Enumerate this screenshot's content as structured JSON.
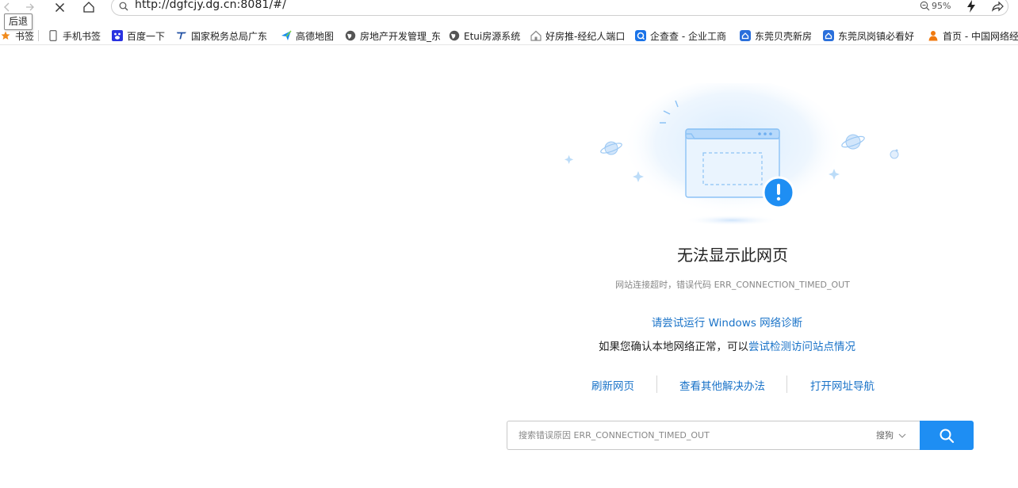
{
  "toolbar": {
    "tooltip": "后退",
    "url": "http://dgfcjy.dg.cn:8081/#/",
    "zoom": "95%",
    "icons": [
      "back-icon",
      "forward-icon",
      "stop-icon",
      "home-icon",
      "search-icon",
      "zoom-icon",
      "lightning-icon",
      "share-icon"
    ]
  },
  "bookmarks": {
    "items": [
      {
        "label": "书签",
        "icon": "star-icon",
        "color": "#f08a1c"
      },
      {
        "label": "手机书签",
        "icon": "phone-icon",
        "color": "#666666"
      },
      {
        "label": "百度一下",
        "icon": "baidu-icon",
        "color": "#2932e1"
      },
      {
        "label": "国家税务总局广东",
        "icon": "tax-icon",
        "color": "#1f4fa3"
      },
      {
        "label": "高德地图",
        "icon": "amap-icon",
        "color": "#1a8cf0"
      },
      {
        "label": "房地产开发管理_东",
        "icon": "globe-icon",
        "color": "#555555"
      },
      {
        "label": "Etui房源系统",
        "icon": "globe-icon",
        "color": "#555555"
      },
      {
        "label": "好房推-经纪人端口",
        "icon": "house-icon",
        "color": "#888888"
      },
      {
        "label": "企查查 - 企业工商",
        "icon": "qcc-icon",
        "color": "#1a73e8"
      },
      {
        "label": "东莞贝壳新房",
        "icon": "ke-icon",
        "color": "#2a6fdb"
      },
      {
        "label": "东莞凤岗镇必看好",
        "icon": "ke-icon",
        "color": "#2a6fdb"
      },
      {
        "label": "首页 - 中国网络经",
        "icon": "person-icon",
        "color": "#f07a10"
      }
    ]
  },
  "error": {
    "title": "无法显示此网页",
    "subtitle": "网站连接超时，错误代码 ERR_CONNECTION_TIMED_OUT",
    "diagnose_link": "请尝试运行 Windows 网络诊断",
    "confirm_prefix": "如果您确认本地网络正常，可以",
    "confirm_link": "尝试检测访问站点情况",
    "actions": [
      "刷新网页",
      "查看其他解决办法",
      "打开网址导航"
    ]
  },
  "search": {
    "placeholder": "搜索错误原因 ERR_CONNECTION_TIMED_OUT",
    "engine": "搜狗",
    "accent": "#1e8ef3"
  },
  "colors": {
    "link": "#1a73c8",
    "alert": "#1e8ef3"
  }
}
